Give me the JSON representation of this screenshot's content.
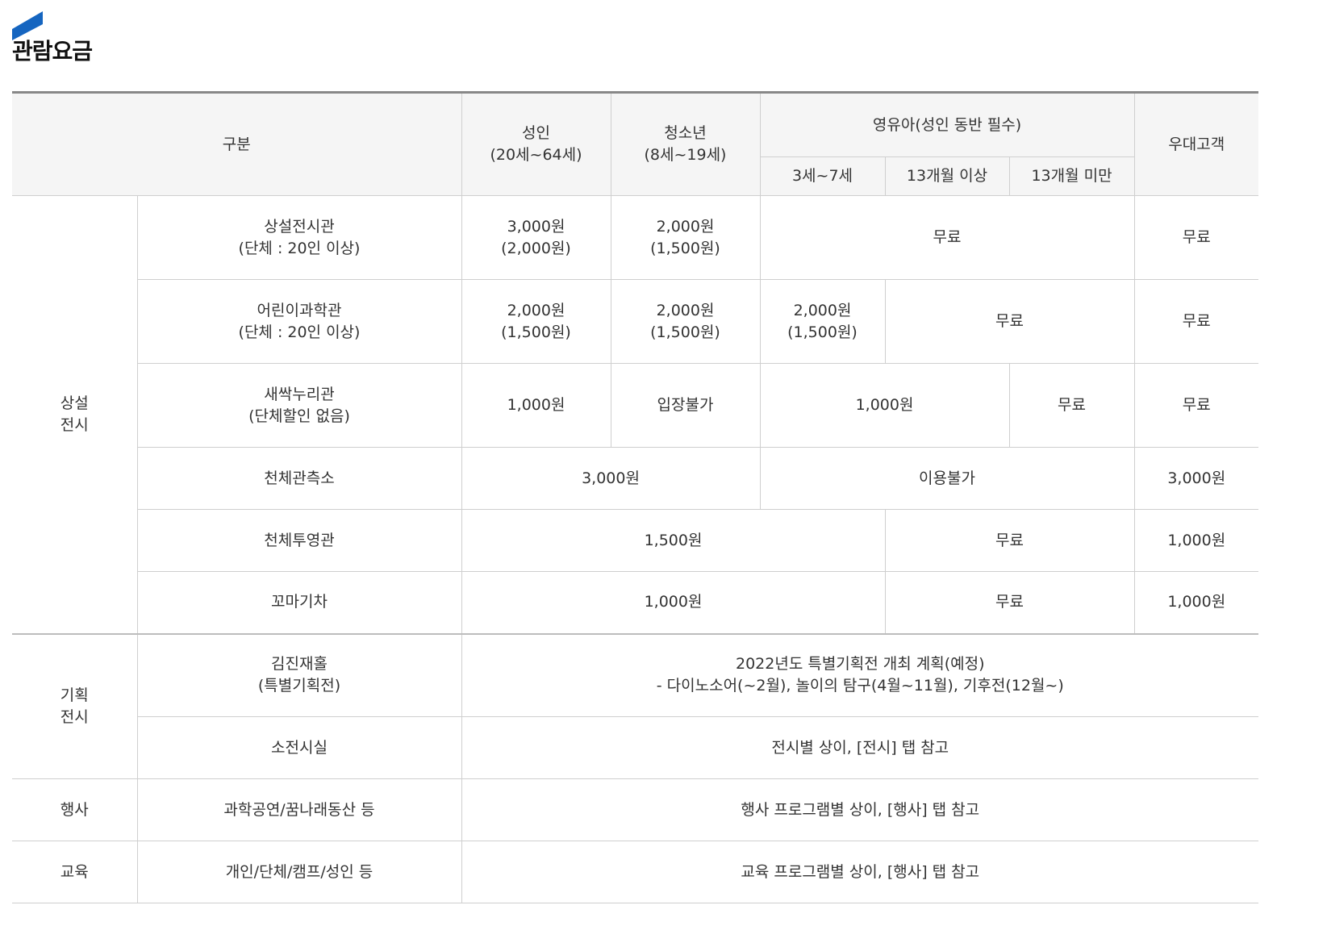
{
  "title": "관람요금",
  "colors": {
    "accent": "#1565c0",
    "header_bg": "#f5f5f5"
  },
  "header": {
    "category": "구분",
    "adult": [
      "성인",
      "(20세~64세)"
    ],
    "youth": [
      "청소년",
      "(8세~19세)"
    ],
    "infant_group": "영유아(성인 동반 필수)",
    "infant_sub": [
      "3세~7세",
      "13개월 이상",
      "13개월 미만"
    ],
    "preferred": "우대고객"
  },
  "rows": {
    "permanent_group": [
      "상설",
      "전시"
    ],
    "permanent_hall": {
      "name": [
        "상설전시관",
        "(단체 : 20인 이상)"
      ],
      "adult": [
        "3,000원",
        "(2,000원)"
      ],
      "youth": [
        "2,000원",
        "(1,500원)"
      ],
      "infant": "무료",
      "preferred": "무료"
    },
    "children_hall": {
      "name": [
        "어린이과학관",
        "(단체 : 20인 이상)"
      ],
      "adult": [
        "2,000원",
        "(1,500원)"
      ],
      "youth": [
        "2,000원",
        "(1,500원)"
      ],
      "age3_7": [
        "2,000원",
        "(1,500원)"
      ],
      "infant_rest": "무료",
      "preferred": "무료"
    },
    "saessak_hall": {
      "name": [
        "새싹누리관",
        "(단체할인 없음)"
      ],
      "adult": "1,000원",
      "youth": "입장불가",
      "age3_13m": "1,000원",
      "under13m": "무료",
      "preferred": "무료"
    },
    "observatory": {
      "name": "천체관측소",
      "adult_youth": "3,000원",
      "infant": "이용불가",
      "preferred": "3,000원"
    },
    "planetarium": {
      "name": "천체투영관",
      "general": "1,500원",
      "infant_rest": "무료",
      "preferred": "1,000원"
    },
    "train": {
      "name": "꼬마기차",
      "general": "1,000원",
      "infant_rest": "무료",
      "preferred": "1,000원"
    },
    "special_group": [
      "기획",
      "전시"
    ],
    "kimjin_hall": {
      "name": [
        "김진재홀",
        "(특별기획전)"
      ],
      "info": [
        "2022년도 특별기획전 개최 계획(예정)",
        "- 다이노소어(~2월), 놀이의 탐구(4월~11월), 기후전(12월~)"
      ]
    },
    "small_hall": {
      "name": "소전시실",
      "info": "전시별 상이, [전시] 탭 참고"
    },
    "event": {
      "group": "행사",
      "name": "과학공연/꿈나래동산 등",
      "info": "행사 프로그램별 상이, [행사] 탭 참고"
    },
    "education": {
      "group": "교육",
      "name": "개인/단체/캠프/성인 등",
      "info": "교육 프로그램별 상이, [행사] 탭 참고"
    }
  }
}
